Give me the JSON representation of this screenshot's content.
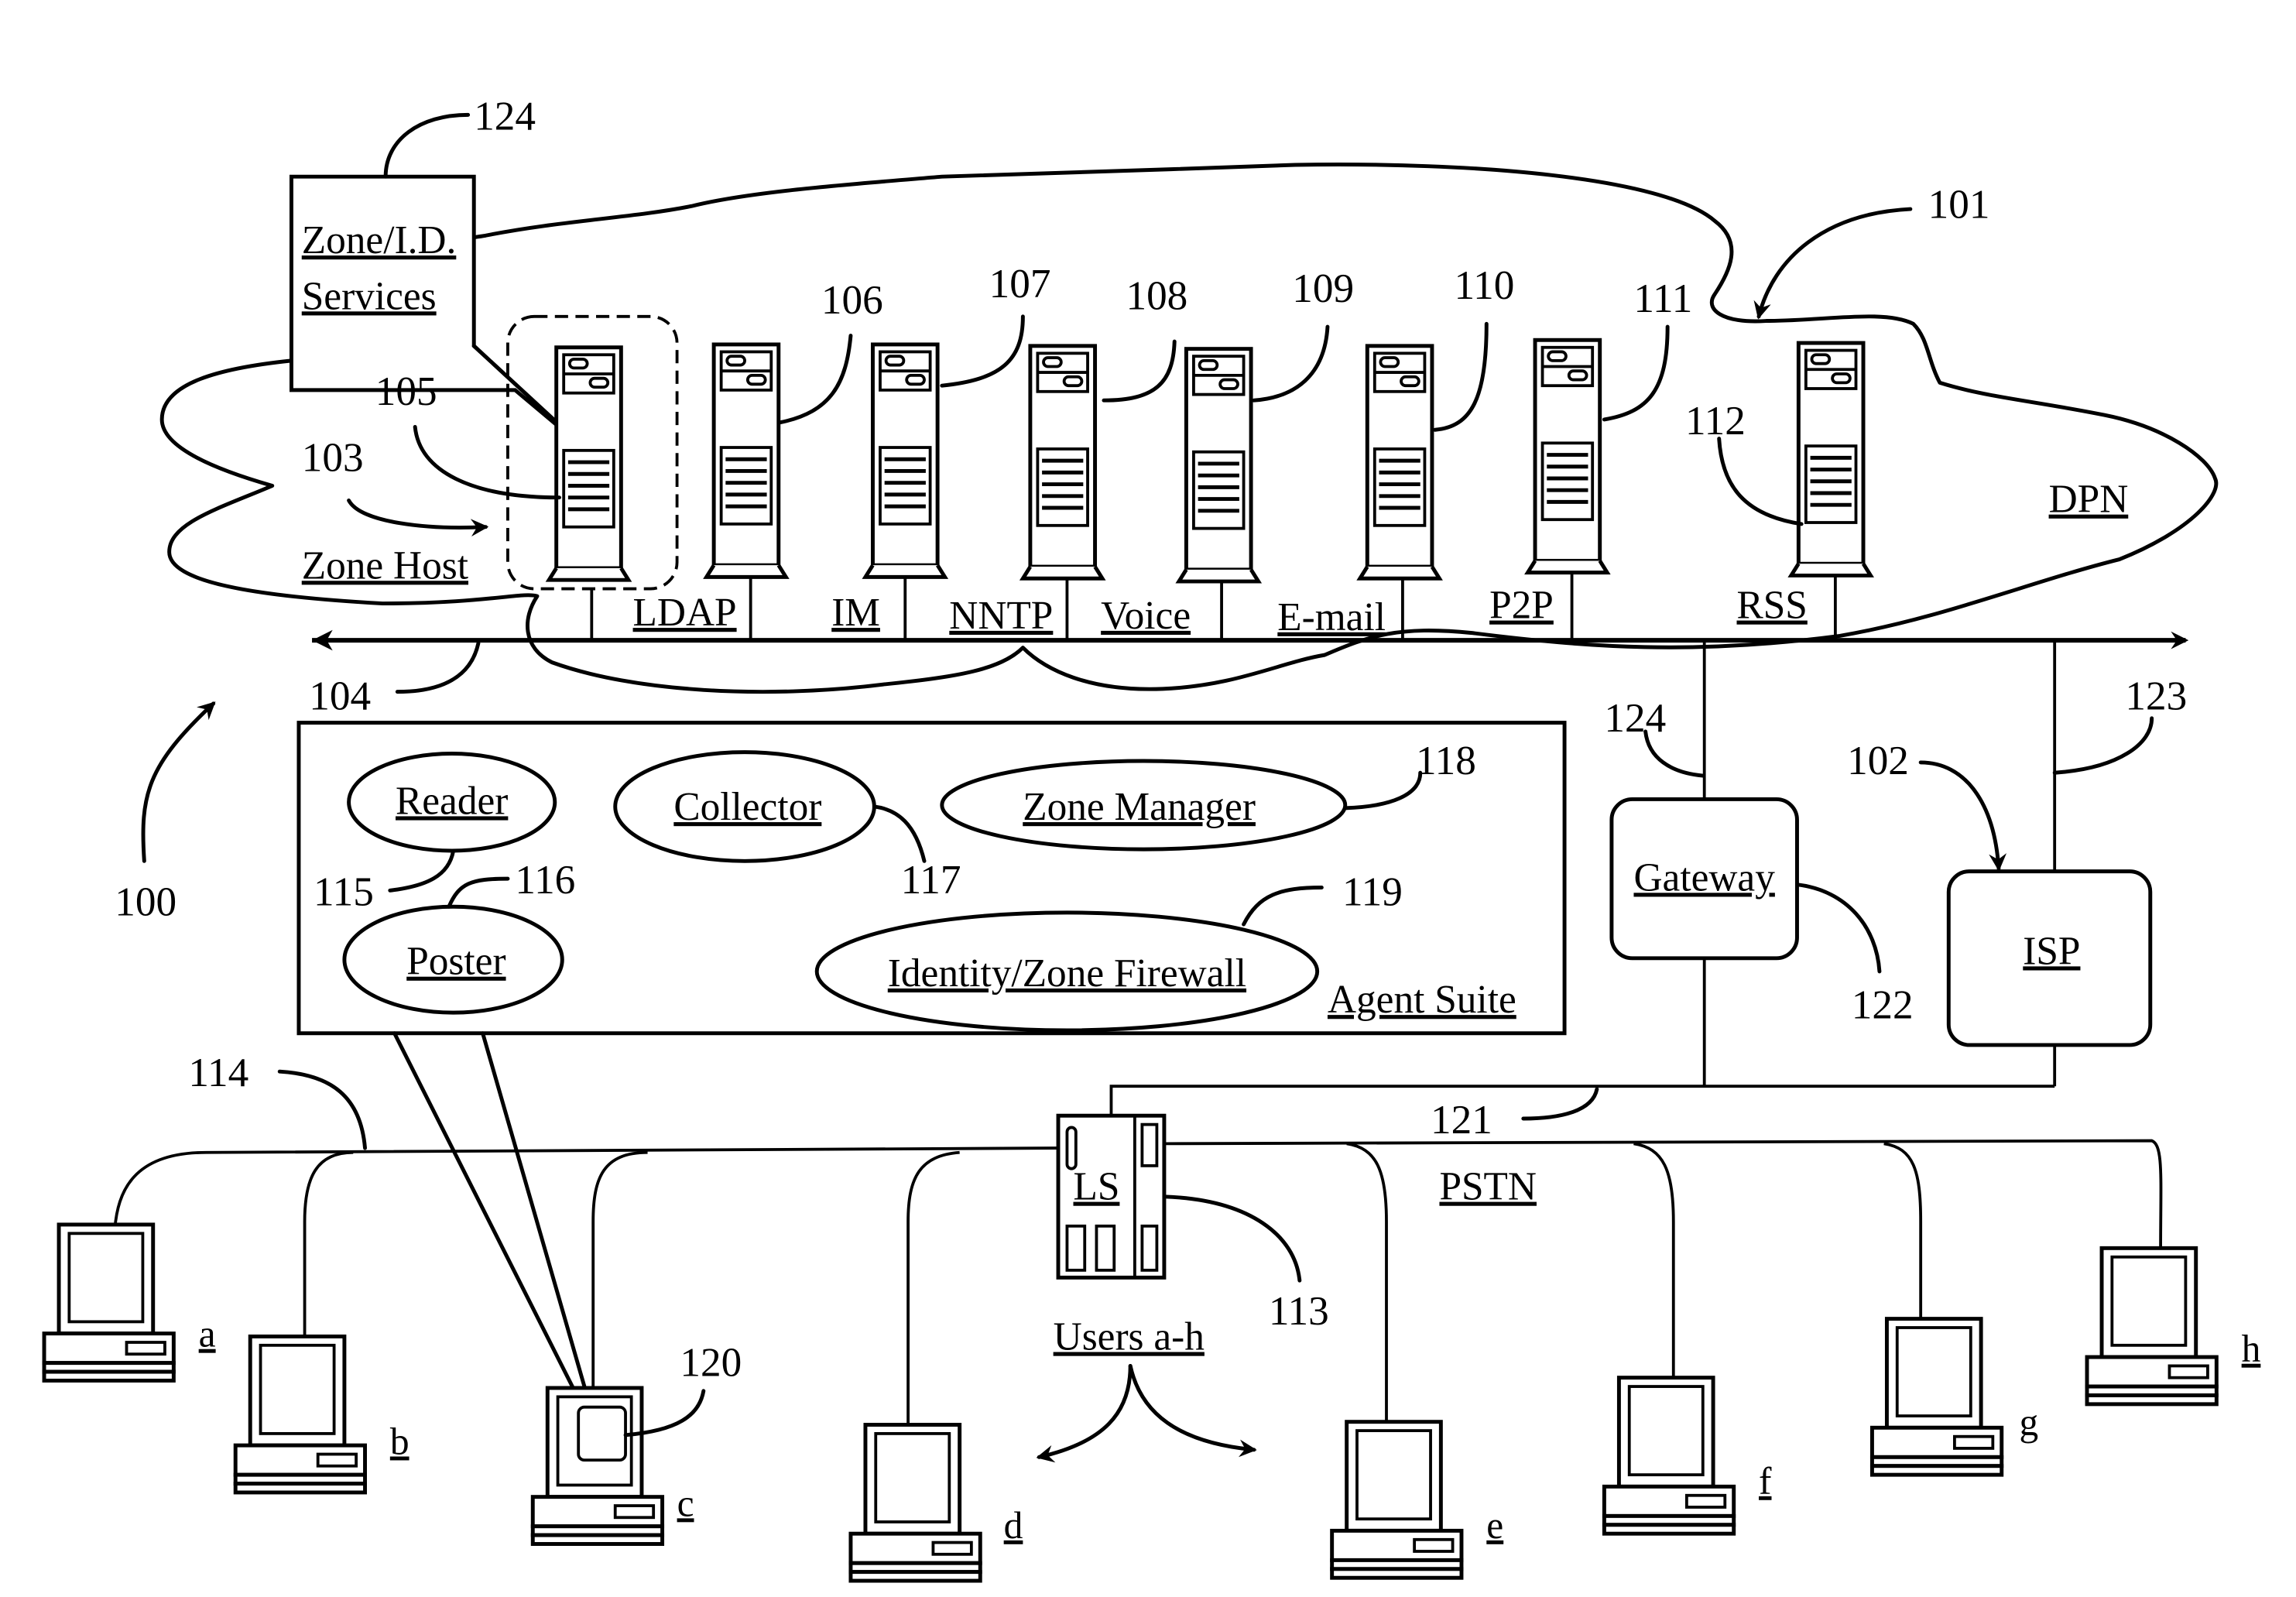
{
  "figure": {
    "system_ref": "100",
    "dpn": {
      "label": "DPN",
      "ref": "101"
    },
    "isp_ref": "102",
    "zone_host": {
      "label": "Zone Host",
      "ref": "103",
      "server_ref": "105"
    },
    "bus_ref": "104",
    "zone_id_services": {
      "line1": "Zone/I.D.",
      "line2": "Services",
      "ref": "124"
    },
    "servers": [
      {
        "label": "LDAP",
        "ref": "106"
      },
      {
        "label": "IM",
        "ref": "107"
      },
      {
        "label": "NNTP",
        "ref": "108"
      },
      {
        "label": "Voice",
        "ref": "109"
      },
      {
        "label": "E-mail",
        "ref": "110"
      },
      {
        "label": "P2P",
        "ref": "111"
      },
      {
        "label": "RSS",
        "ref": "112"
      }
    ],
    "agent_suite": {
      "title": "Agent Suite",
      "agents": [
        {
          "label": "Reader",
          "ref": "115"
        },
        {
          "label": "Poster",
          "ref": "116"
        },
        {
          "label": "Collector",
          "ref": "117"
        },
        {
          "label": "Zone Manager",
          "ref": "118"
        },
        {
          "label": "Identity/Zone Firewall",
          "ref": "119"
        }
      ]
    },
    "gateway": {
      "label": "Gateway",
      "ref": "122",
      "link_ref": "124"
    },
    "isp": {
      "label": "ISP",
      "link_ref": "123"
    },
    "ls": {
      "label": "LS",
      "ref": "113",
      "link_ref": "121"
    },
    "pstn_label": "PSTN",
    "user_line_ref": "114",
    "agent_on_user_ref": "120",
    "users_caption": "Users a-h",
    "users": [
      "a",
      "b",
      "c",
      "d",
      "e",
      "f",
      "g",
      "h"
    ]
  }
}
